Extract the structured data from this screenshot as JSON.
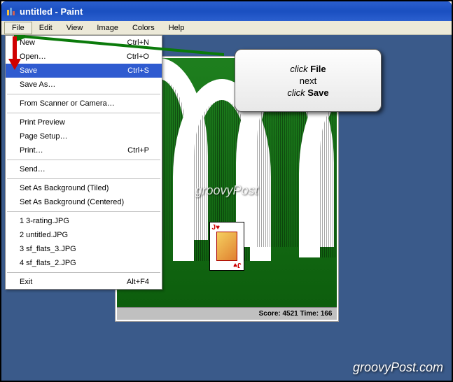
{
  "window": {
    "title": "untitled - Paint"
  },
  "menubar": {
    "items": [
      "File",
      "Edit",
      "View",
      "Image",
      "Colors",
      "Help"
    ]
  },
  "file_menu": {
    "new_label": "New",
    "new_accel": "Ctrl+N",
    "open_label": "Open…",
    "open_accel": "Ctrl+O",
    "save_label": "Save",
    "save_accel": "Ctrl+S",
    "saveas_label": "Save As…",
    "scanner_label": "From Scanner or Camera…",
    "preview_label": "Print Preview",
    "pagesetup_label": "Page Setup…",
    "print_label": "Print…",
    "print_accel": "Ctrl+P",
    "send_label": "Send…",
    "bg_tiled_label": "Set As Background (Tiled)",
    "bg_center_label": "Set As Background (Centered)",
    "recent1": "1 3-rating.JPG",
    "recent2": "2 untitled.JPG",
    "recent3": "3 sf_flats_3.JPG",
    "recent4": "4 sf_flats_2.JPG",
    "exit_label": "Exit",
    "exit_accel": "Alt+F4"
  },
  "tooltip": {
    "line1_prefix": "click",
    "line1_bold": "File",
    "line2": "next",
    "line3_prefix": "click",
    "line3_bold": "Save"
  },
  "game_status": {
    "score_label": "Score:",
    "score_value": "4521",
    "time_label": "Time:",
    "time_value": "166"
  },
  "card": {
    "rank": "J",
    "suit": "♥"
  },
  "watermark": "groovyPost",
  "footer_watermark": "groovyPost.com"
}
